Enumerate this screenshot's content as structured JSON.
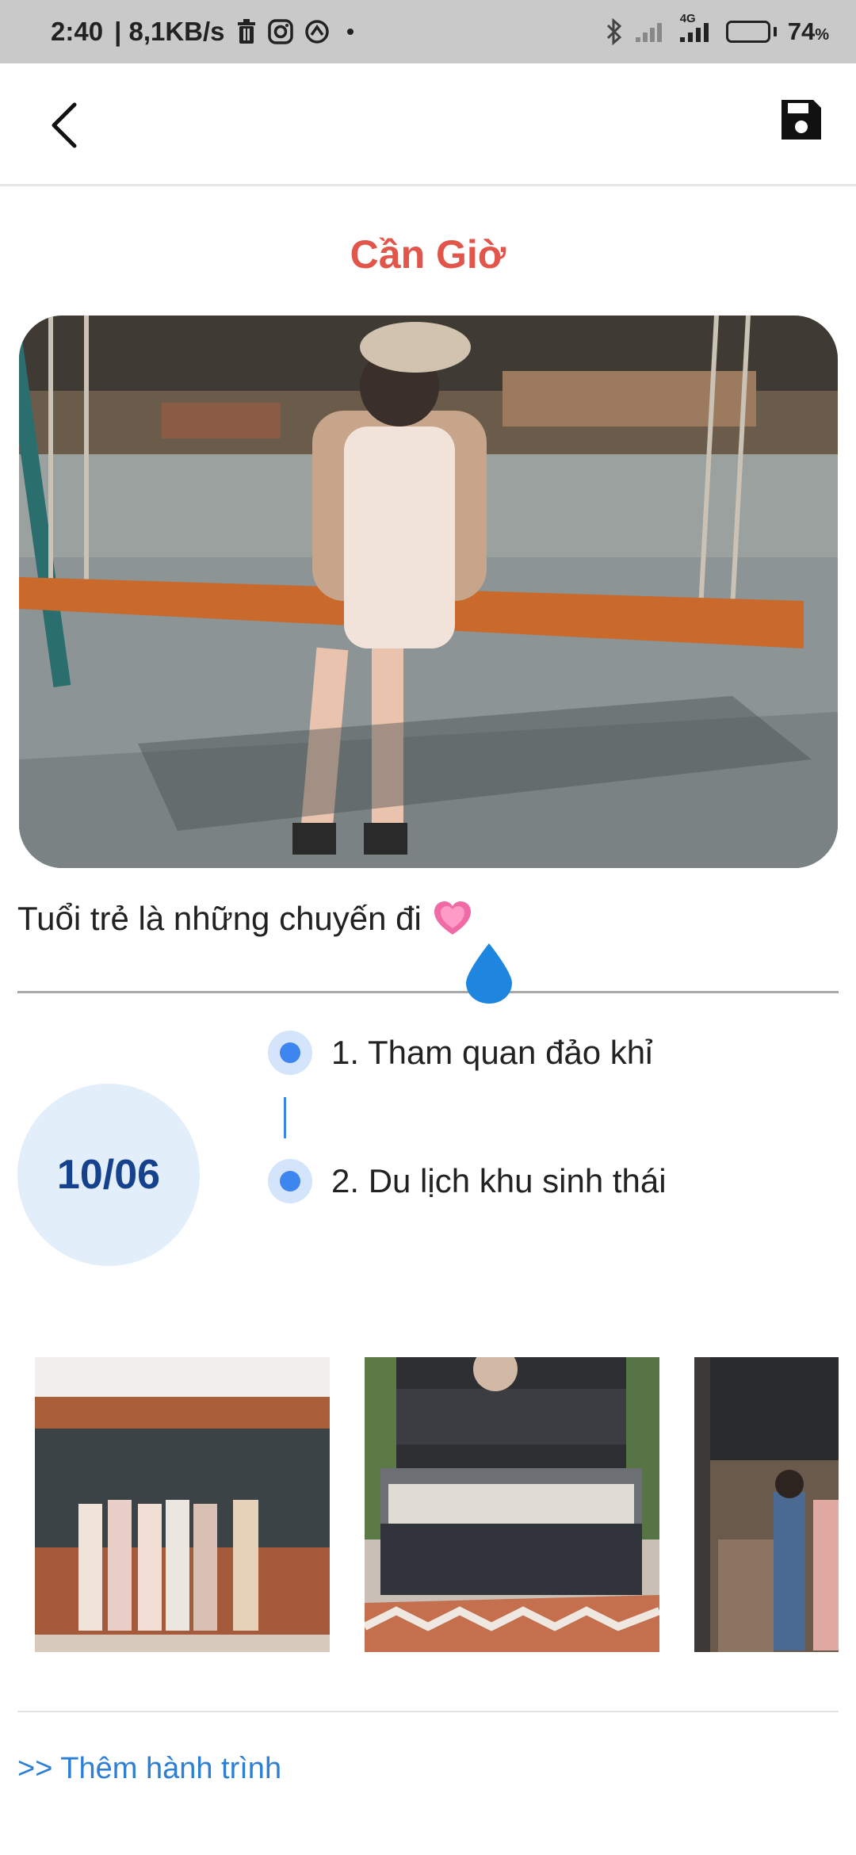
{
  "status_bar": {
    "time": "2:40",
    "speed": "| 8,1KB/s",
    "network": "4G",
    "battery_percent": "74",
    "battery_unit": "%"
  },
  "colors": {
    "title": "#e2554b",
    "accent_blue": "#3d86f0",
    "date_bg": "#e3eefb",
    "date_text": "#16418c",
    "link": "#2d7fd4"
  },
  "trip": {
    "title": "Cần Giờ",
    "caption": "Tuổi trẻ là những chuyến đi",
    "date": "10/06",
    "steps": [
      {
        "label": "1. Tham quan đảo khỉ"
      },
      {
        "label": "2. Du lịch khu sinh thái"
      }
    ]
  },
  "footer": {
    "add_link": ">> Thêm hành trình"
  }
}
